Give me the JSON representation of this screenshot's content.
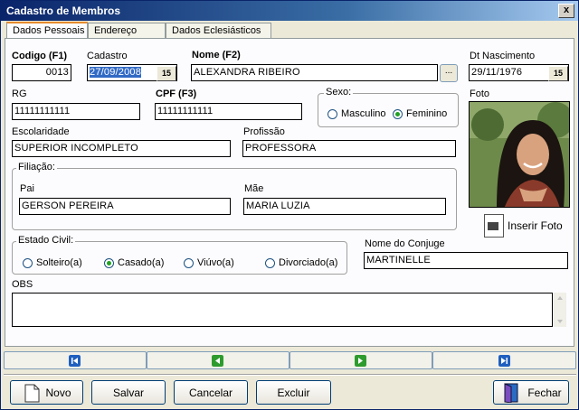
{
  "window": {
    "title": "Cadastro de Membros",
    "close": "x"
  },
  "tabs": [
    "Dados Pessoais",
    "Endereço",
    "Dados Eclesiásticos"
  ],
  "fields": {
    "codigo_label": "Codigo (F1)",
    "codigo": "0013",
    "cadastro_label": "Cadastro",
    "cadastro": "27/09/2008",
    "nome_label": "Nome (F2)",
    "nome": "ALEXANDRA RIBEIRO",
    "nasc_label": "Dt Nascimento",
    "nasc": "29/11/1976",
    "rg_label": "RG",
    "rg": "11111111111",
    "cpf_label": "CPF (F3)",
    "cpf": "11111111111",
    "escolaridade_label": "Escolaridade",
    "escolaridade": "SUPERIOR INCOMPLETO",
    "profissao_label": "Profissão",
    "profissao": "PROFESSORA",
    "pai_label": "Pai",
    "pai": "GERSON PEREIRA",
    "mae_label": "Mãe",
    "mae": "MARIA LUZIA",
    "conjuge_label": "Nome do Conjuge",
    "conjuge": "MARTINELLE",
    "obs_label": "OBS",
    "foto_label": "Foto"
  },
  "calendar_btn": "15",
  "ellipsis": "...",
  "sexo": {
    "title": "Sexo:",
    "options": [
      "Masculino",
      "Feminino"
    ],
    "selected": "Feminino"
  },
  "filiacao_title": "Filiação:",
  "estado_civil": {
    "title": "Estado Civil:",
    "options": [
      "Solteiro(a)",
      "Casado(a)",
      "Viúvo(a)",
      "Divorciado(a)"
    ],
    "selected": "Casado(a)"
  },
  "inserir_foto": "Inserir Foto",
  "navigation": {
    "icons": [
      "first-icon",
      "prev-icon",
      "next-icon",
      "last-icon"
    ],
    "colors": {
      "blue": "#1f5fbf",
      "green": "#2e9b2e"
    }
  },
  "buttons": {
    "novo": "Novo",
    "salvar": "Salvar",
    "cancelar": "Cancelar",
    "excluir": "Excluir",
    "fechar": "Fechar"
  }
}
